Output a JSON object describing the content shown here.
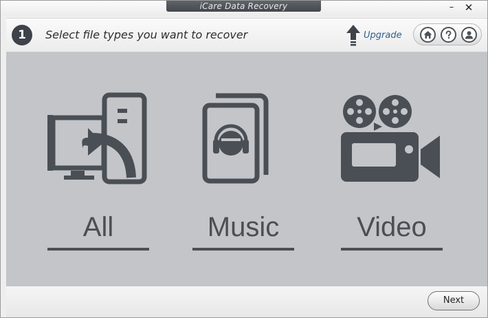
{
  "window": {
    "title": "iCare Data Recovery",
    "minimize_glyph": "–",
    "close_glyph": "✕"
  },
  "header": {
    "step_number": "1",
    "step_title": "Select file types you want to recover",
    "upgrade_label": "Upgrade",
    "upgrade_icon": "up-arrow-icon",
    "icons": [
      "home-icon",
      "help-icon",
      "account-icon"
    ]
  },
  "categories": [
    {
      "label": "All",
      "icon": "computer-transfer-icon"
    },
    {
      "label": "Music",
      "icon": "music-headphones-icon"
    },
    {
      "label": "Video",
      "icon": "video-camera-icon"
    }
  ],
  "footer": {
    "next_label": "Next"
  },
  "colors": {
    "title_tab": "#44484d",
    "main_bg": "#c3c5c8",
    "icon_dark": "#4a4f55",
    "upgrade_link": "#2f5f8a",
    "step_badge": "#3e4349"
  }
}
